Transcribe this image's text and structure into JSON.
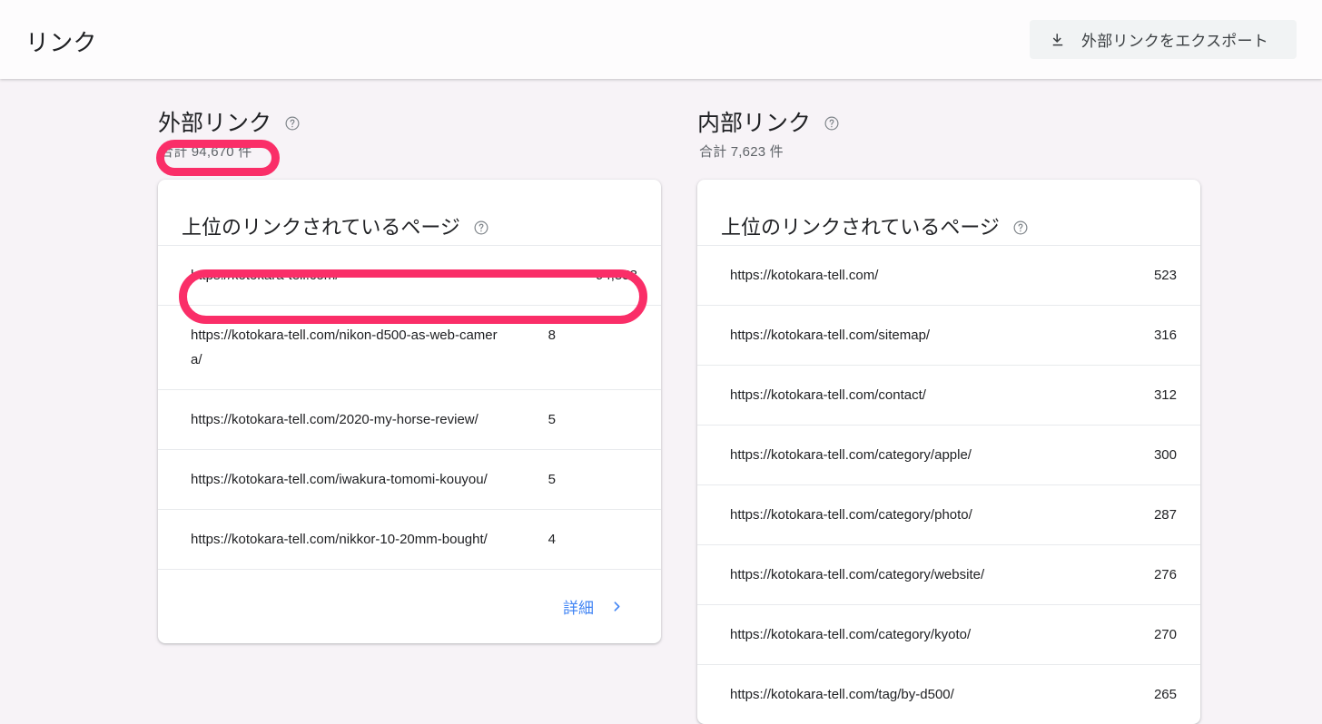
{
  "header": {
    "title": "リンク",
    "export_button": {
      "label": "外部リンクをエクスポート",
      "icon": "download-icon"
    }
  },
  "colors": {
    "accent_link": "#4285F4",
    "annotation": "#FA2E68",
    "page_background": "#F7F3F7",
    "card_background": "#FFFFFF",
    "button_background": "#F1F3F4"
  },
  "external": {
    "section_title": "外部リンク",
    "total": "合計 94,670 件",
    "card_title": "上位のリンクされているページ",
    "rows": [
      {
        "url": "https://kotokara-tell.com/",
        "count": "94,558"
      },
      {
        "url": "https://kotokara-tell.com/nikon-d500-as-web-camera/",
        "count": "8"
      },
      {
        "url": "https://kotokara-tell.com/2020-my-horse-review/",
        "count": "5"
      },
      {
        "url": "https://kotokara-tell.com/iwakura-tomomi-kouyou/",
        "count": "5"
      },
      {
        "url": "https://kotokara-tell.com/nikkor-10-20mm-bought/",
        "count": "4"
      }
    ],
    "more_label": "詳細"
  },
  "internal": {
    "section_title": "内部リンク",
    "total": "合計 7,623 件",
    "card_title": "上位のリンクされているページ",
    "rows": [
      {
        "url": "https://kotokara-tell.com/",
        "count": "523"
      },
      {
        "url": "https://kotokara-tell.com/sitemap/",
        "count": "316"
      },
      {
        "url": "https://kotokara-tell.com/contact/",
        "count": "312"
      },
      {
        "url": "https://kotokara-tell.com/category/apple/",
        "count": "300"
      },
      {
        "url": "https://kotokara-tell.com/category/photo/",
        "count": "287"
      },
      {
        "url": "https://kotokara-tell.com/category/website/",
        "count": "276"
      },
      {
        "url": "https://kotokara-tell.com/category/kyoto/",
        "count": "270"
      },
      {
        "url": "https://kotokara-tell.com/tag/by-d500/",
        "count": "265"
      }
    ]
  },
  "annotations": [
    {
      "name": "external-total-highlight",
      "target": "合計 94,670 件"
    },
    {
      "name": "external-top-row-highlight",
      "target": "https://kotokara-tell.com/ 94,558"
    }
  ]
}
